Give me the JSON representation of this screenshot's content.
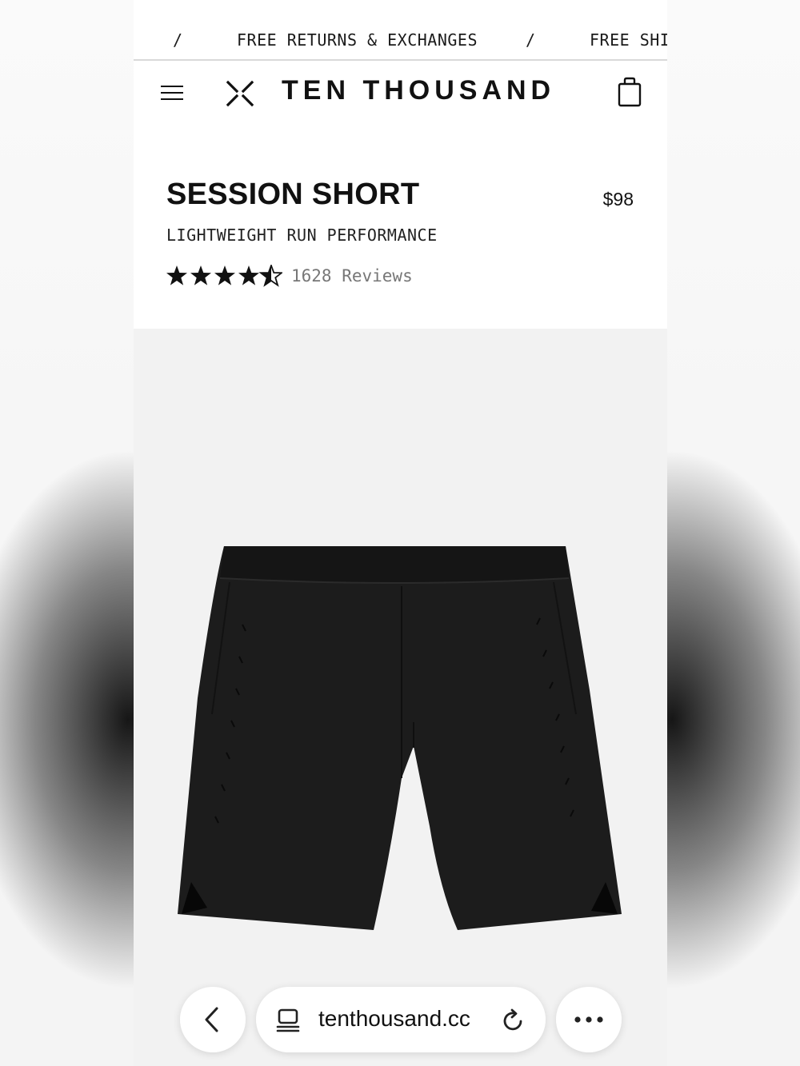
{
  "announcement": {
    "items": [
      "/",
      "FREE RETURNS & EXCHANGES",
      "/",
      "FREE SHI"
    ]
  },
  "header": {
    "menu_icon": "hamburger-menu-icon",
    "logo_icon": "x-logo-icon",
    "brand": "TEN THOUSAND",
    "cart_icon": "shopping-bag-icon"
  },
  "product": {
    "title": "SESSION SHORT",
    "price": "$98",
    "subtitle": "LIGHTWEIGHT RUN PERFORMANCE",
    "rating": 4.5,
    "reviews": "1628 Reviews",
    "image_alt": "black running shorts product photo"
  },
  "browser": {
    "back_icon": "chevron-left-icon",
    "tab_icon": "tabs-icon",
    "url": "tenthousand.cc",
    "reload_icon": "reload-icon",
    "more_icon": "ellipsis-icon"
  },
  "colors": {
    "text": "#111111",
    "muted": "#777777",
    "gallery_bg": "#f2f2f2",
    "divider": "#d9d9d9"
  }
}
